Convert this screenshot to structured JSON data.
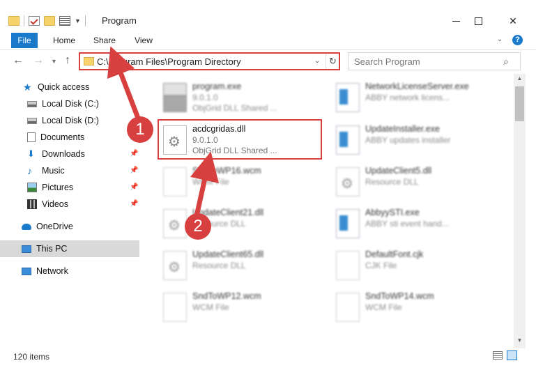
{
  "window": {
    "title": "Program"
  },
  "ribbon": {
    "tabs": [
      "File",
      "Home",
      "Share",
      "View"
    ]
  },
  "navbar": {
    "address": "C:\\Program Files\\Program Directory",
    "search_placeholder": "Search Program"
  },
  "sidebar": {
    "items": [
      {
        "label": "Quick access",
        "icon": "star-icon"
      },
      {
        "label": "Local Disk (C:)",
        "icon": "disk-icon"
      },
      {
        "label": "Local Disk (D:)",
        "icon": "disk-icon"
      },
      {
        "label": "Documents",
        "icon": "documents-icon",
        "pinned": true
      },
      {
        "label": "Downloads",
        "icon": "downloads-icon",
        "pinned": true
      },
      {
        "label": "Music",
        "icon": "music-icon",
        "pinned": true
      },
      {
        "label": "Pictures",
        "icon": "pictures-icon",
        "pinned": true
      },
      {
        "label": "Videos",
        "icon": "videos-icon",
        "pinned": true
      },
      {
        "label": "OneDrive",
        "icon": "cloud-icon"
      },
      {
        "label": "This PC",
        "icon": "pc-icon",
        "selected": true
      },
      {
        "label": "Network",
        "icon": "network-icon"
      }
    ]
  },
  "files": [
    {
      "name": "program.exe",
      "line2": "9.0.1.0",
      "line3": "ObjGrid DLL Shared ...",
      "icon": "program-icon"
    },
    {
      "name": "NetworkLicenseServer.exe",
      "line2": "ABBY network licens...",
      "line3": "",
      "icon": "exe-icon"
    },
    {
      "name": "acdcgridas.dll",
      "line2": "9.0.1.0",
      "line3": "ObjGrid DLL Shared ...",
      "icon": "dll-icon"
    },
    {
      "name": "UpdateInstaller.exe",
      "line2": "ABBY updates installer",
      "line3": "",
      "icon": "exe-icon"
    },
    {
      "name": "SndToWP16.wcm",
      "line2": "WCM File",
      "line3": "",
      "icon": "doc-icon"
    },
    {
      "name": "UpdateClient5.dll",
      "line2": "Resource DLL",
      "line3": "",
      "icon": "dll-icon"
    },
    {
      "name": "UpdateClient21.dll",
      "line2": "Resource DLL",
      "line3": "",
      "icon": "dll-icon"
    },
    {
      "name": "AbbyySTI.exe",
      "line2": "ABBY sti event hand...",
      "line3": "",
      "icon": "exe-icon"
    },
    {
      "name": "UpdateClient65.dll",
      "line2": "Resource DLL",
      "line3": "",
      "icon": "dll-icon"
    },
    {
      "name": "DefaultFont.cjk",
      "line2": "CJK File",
      "line3": "",
      "icon": "doc-icon"
    },
    {
      "name": "SndToWP12.wcm",
      "line2": "WCM File",
      "line3": "",
      "icon": "doc-icon"
    },
    {
      "name": "SndToWP14.wcm",
      "line2": "WCM File",
      "line3": "",
      "icon": "doc-icon"
    }
  ],
  "status": {
    "item_count": "120 items"
  },
  "annotations": {
    "badge1": "1",
    "badge2": "2"
  },
  "colors": {
    "accent": "#1979ca",
    "highlight": "#d8403f"
  }
}
